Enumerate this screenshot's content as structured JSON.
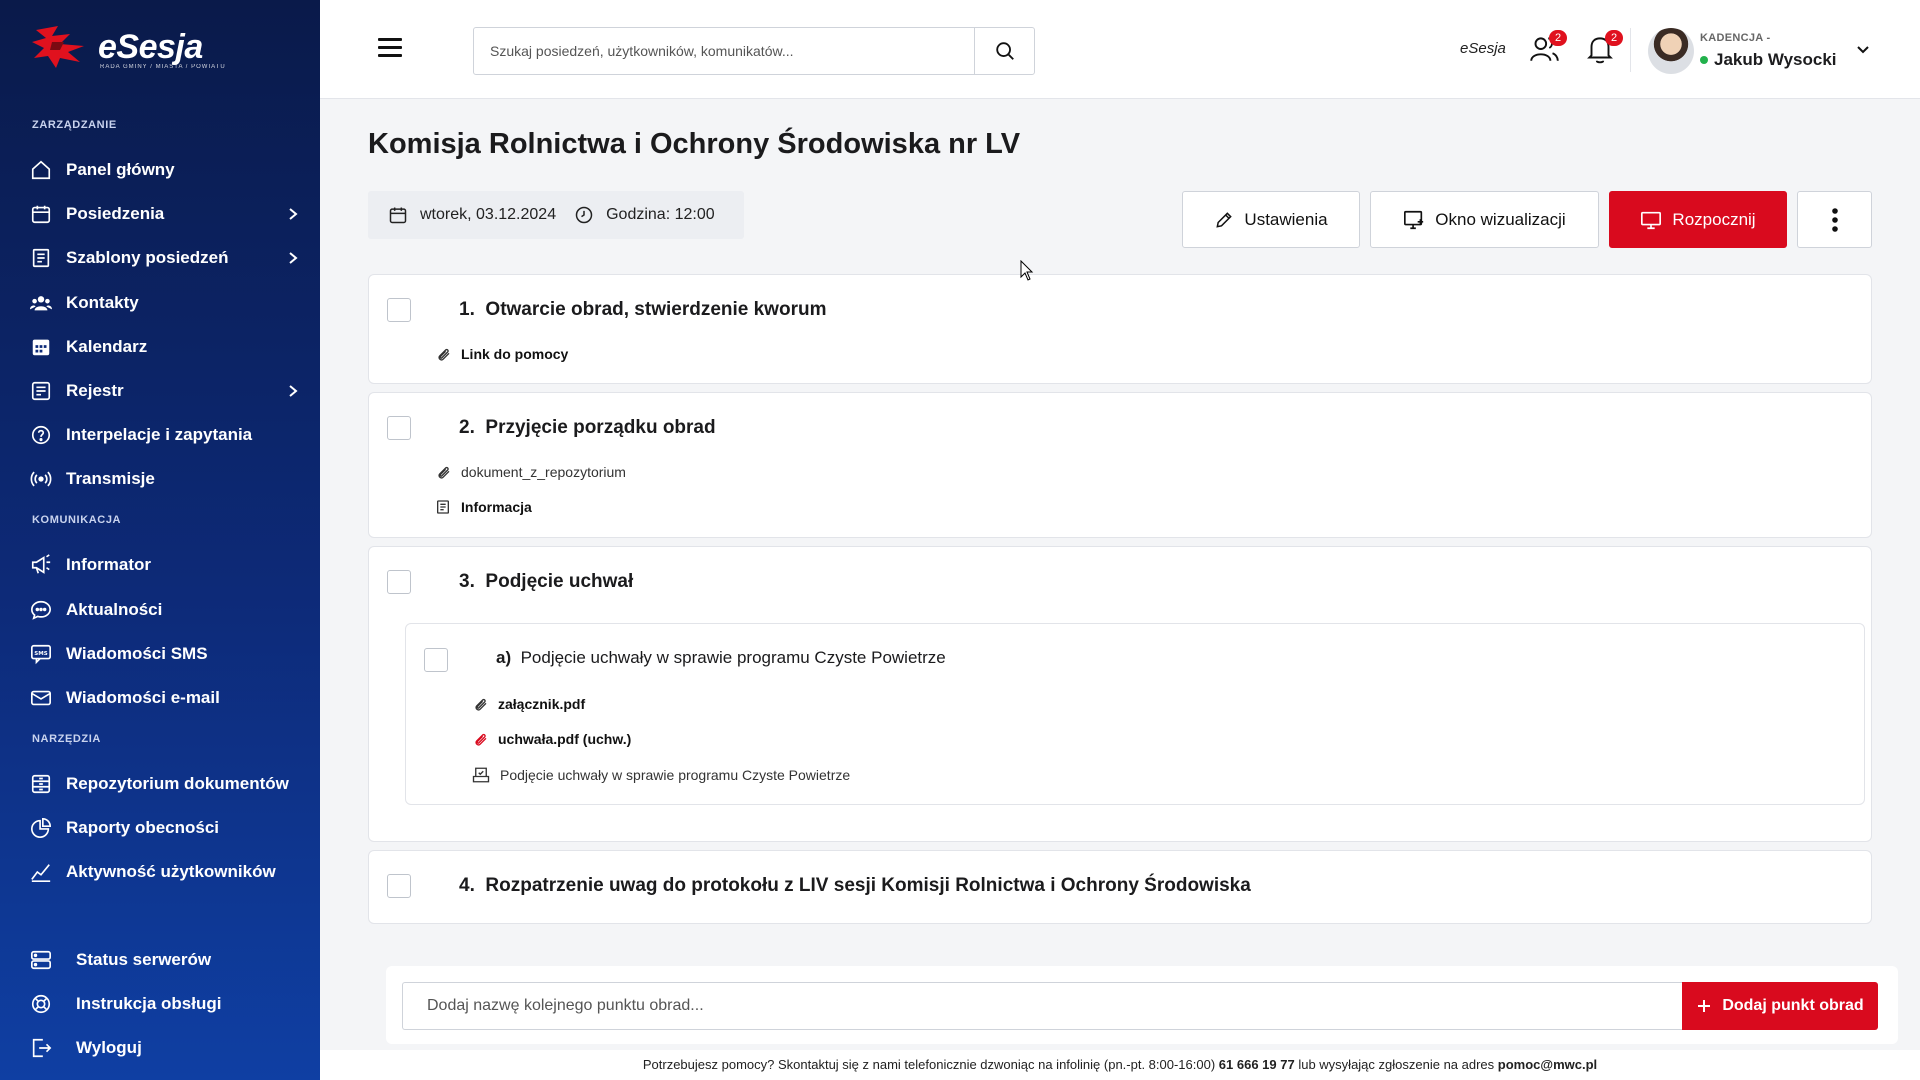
{
  "app": {
    "logo_text": "eSesja",
    "logo_sub": "RADA GMINY / MIASTA / POWIATU"
  },
  "sidebar": {
    "sections": {
      "management": "ZARZĄDZANIE",
      "communication": "KOMUNIKACJA",
      "tools": "NARZĘDZIA"
    },
    "items": [
      {
        "label": "Panel główny",
        "icon": "home-icon"
      },
      {
        "label": "Posiedzenia",
        "icon": "calendar-icon",
        "has_children": true
      },
      {
        "label": "Szablony posiedzeń",
        "icon": "template-icon",
        "has_children": true
      },
      {
        "label": "Kontakty",
        "icon": "contacts-icon"
      },
      {
        "label": "Kalendarz",
        "icon": "calendar-grid-icon"
      },
      {
        "label": "Rejestr",
        "icon": "register-icon",
        "has_children": true
      },
      {
        "label": "Interpelacje i zapytania",
        "icon": "question-icon"
      },
      {
        "label": "Transmisje",
        "icon": "broadcast-icon"
      },
      {
        "label": "Informator",
        "icon": "megaphone-icon"
      },
      {
        "label": "Aktualności",
        "icon": "chat-icon"
      },
      {
        "label": "Wiadomości SMS",
        "icon": "sms-icon"
      },
      {
        "label": "Wiadomości e-mail",
        "icon": "mail-icon"
      },
      {
        "label": "Repozytorium dokumentów",
        "icon": "repository-icon"
      },
      {
        "label": "Raporty obecności",
        "icon": "pie-chart-icon"
      },
      {
        "label": "Aktywność użytkowników",
        "icon": "activity-icon"
      }
    ],
    "bottom": [
      {
        "label": "Status serwerów",
        "icon": "server-icon"
      },
      {
        "label": "Instrukcja obsługi",
        "icon": "lifebuoy-icon"
      },
      {
        "label": "Wyloguj",
        "icon": "logout-icon"
      }
    ]
  },
  "topbar": {
    "search_placeholder": "Szukaj posiedzeń, użytkowników, komunikatów...",
    "brand_link": "eSesja",
    "users_badge": "2",
    "notifications_badge": "2",
    "user_term": "KADENCJA -",
    "user_name": "Jakub Wysocki"
  },
  "meeting": {
    "title": "Komisja Rolnictwa i Ochrony Środowiska nr LV",
    "date": "wtorek, 03.12.2024",
    "time": "Godzina: 12:00",
    "buttons": {
      "settings": "Ustawienia",
      "visualization": "Okno wizualizacji",
      "start": "Rozpocznij"
    }
  },
  "agenda": [
    {
      "number": "1.",
      "title": "Otwarcie obrad, stwierdzenie kworum",
      "attachments": [
        {
          "label": "Link do pomocy",
          "type": "link"
        }
      ]
    },
    {
      "number": "2.",
      "title": "Przyjęcie porządku obrad",
      "attachments": [
        {
          "label": "dokument_z_repozytorium",
          "type": "link"
        },
        {
          "label": "Informacja",
          "type": "note"
        }
      ]
    },
    {
      "number": "3.",
      "title": "Podjęcie uchwał",
      "subitems": [
        {
          "letter": "a)",
          "title": "Podjęcie uchwały w sprawie programu Czyste Powietrze",
          "attachments": [
            {
              "label": "załącznik.pdf",
              "type": "link"
            },
            {
              "label": "uchwała.pdf (uchw.)",
              "type": "resolution"
            },
            {
              "label": "Podjęcie uchwały w sprawie programu Czyste Powietrze",
              "type": "vote"
            }
          ]
        }
      ]
    },
    {
      "number": "4.",
      "title": "Rozpatrzenie uwag do protokołu z LIV sesji Komisji Rolnictwa i Ochrony Środowiska"
    }
  ],
  "add_item": {
    "placeholder": "Dodaj nazwę kolejnego punktu obrad...",
    "button": "Dodaj punkt obrad"
  },
  "footer": {
    "text_before": "Potrzebujesz pomocy? Skontaktuj się z nami telefonicznie dzwoniąc na infolinię (pn.-pt. 8:00-16:00)",
    "phone": "61 666 19 77",
    "text_middle": "lub wysyłając zgłoszenie na adres",
    "email": "pomoc@mwc.pl"
  },
  "colors": {
    "accent_red": "#d90a1e",
    "sidebar_top": "#0a1a4a",
    "sidebar_bottom": "#0f3fa3"
  }
}
